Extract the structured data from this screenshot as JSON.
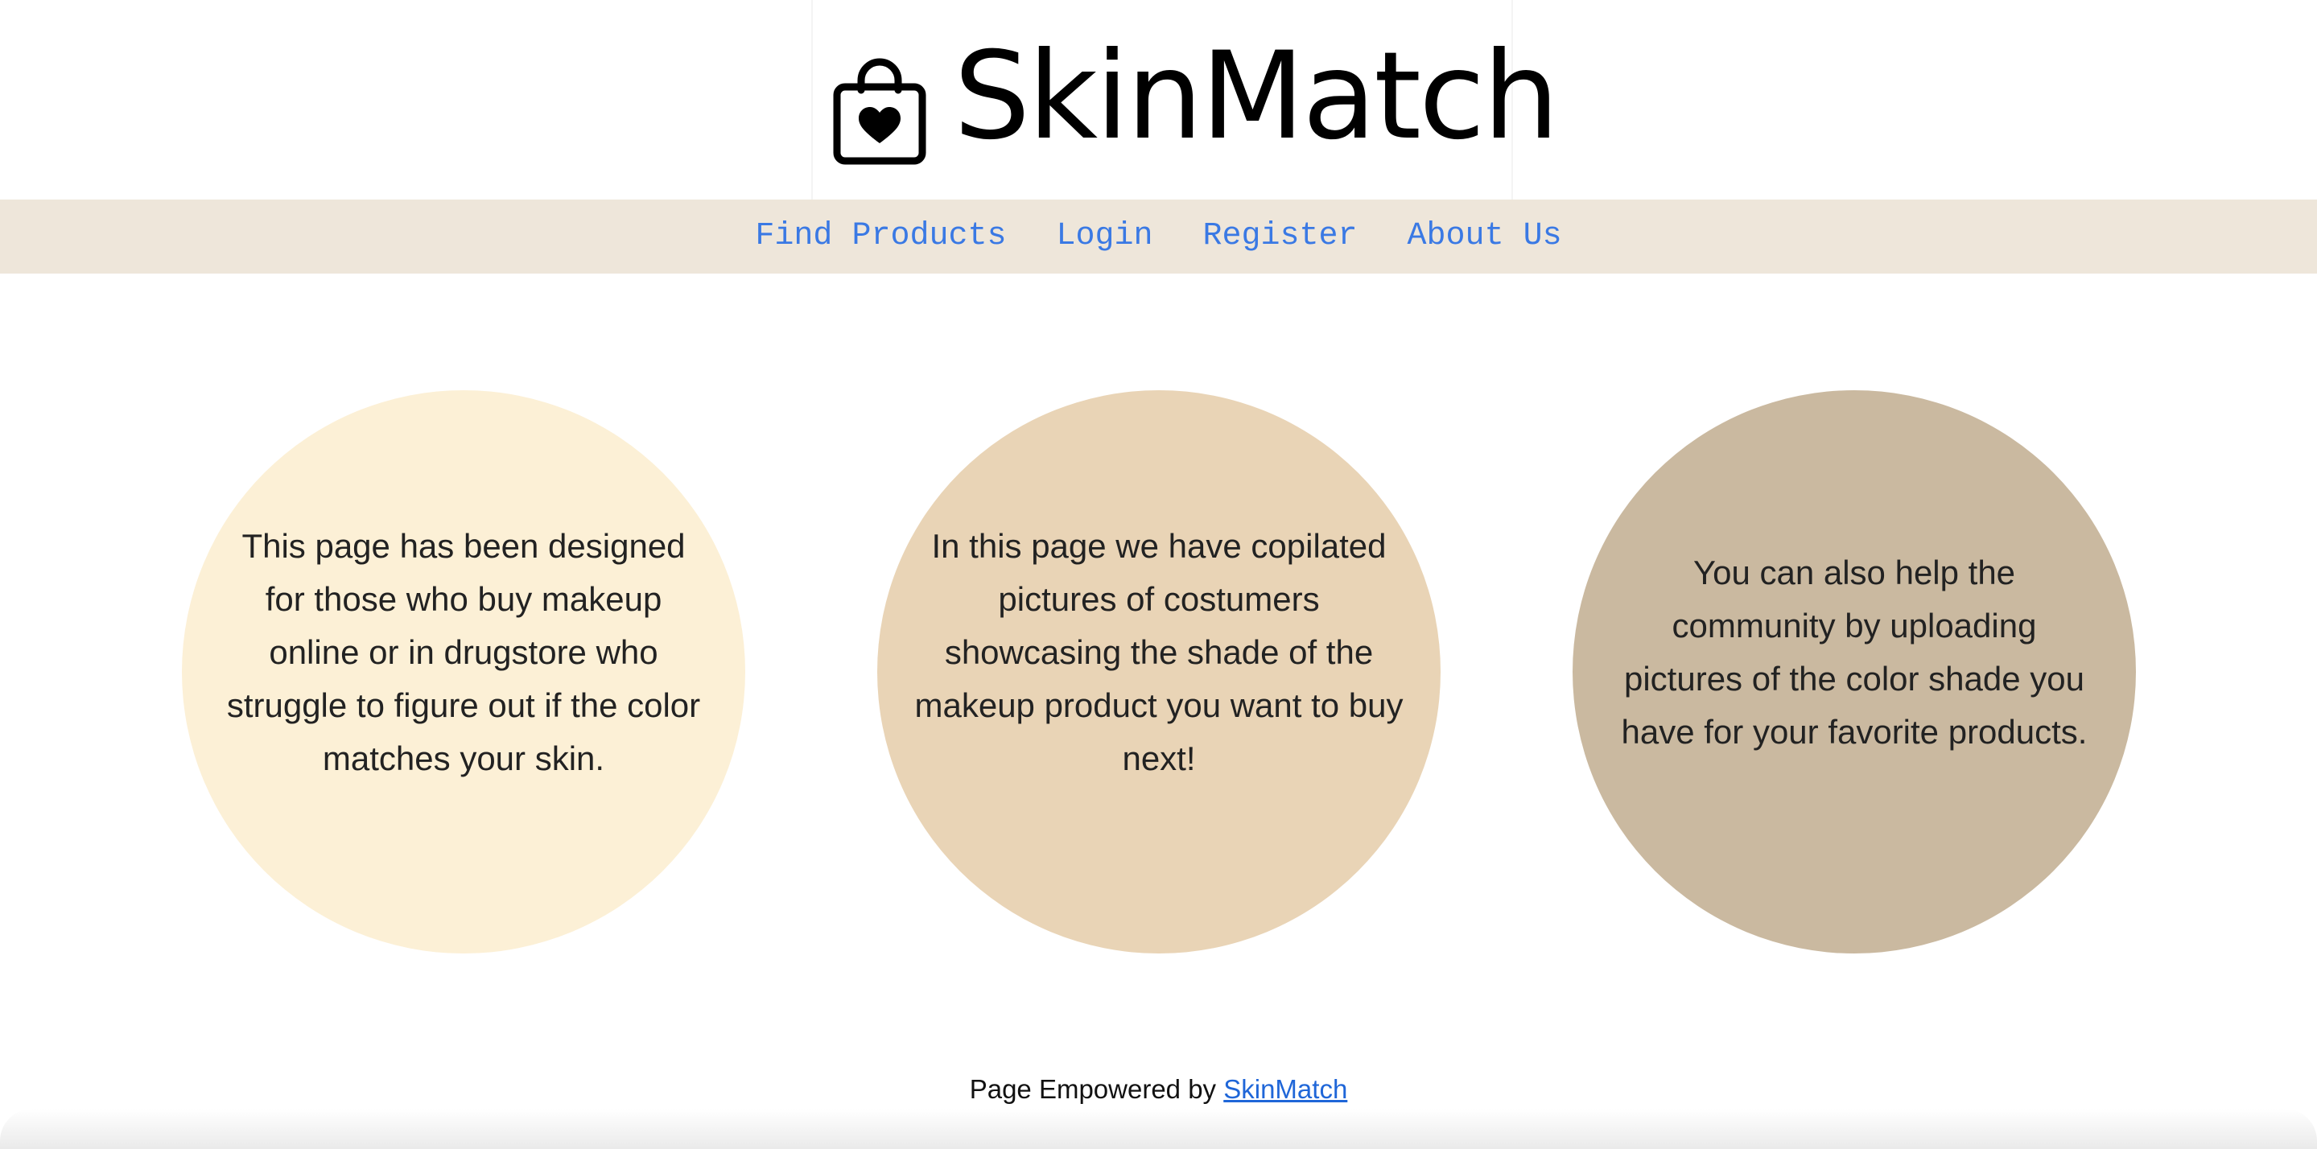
{
  "header": {
    "logo_icon": "shopping-bag-heart-icon",
    "logo_text": "SkinMatch"
  },
  "nav": {
    "items": [
      {
        "label": "Find Products"
      },
      {
        "label": "Login"
      },
      {
        "label": "Register"
      },
      {
        "label": "About Us"
      }
    ]
  },
  "circles": [
    {
      "text": "This page has been designed for those who buy makeup online or in drugstore who struggle to figure out if the color matches your skin.",
      "color": "#fcf0d6"
    },
    {
      "text": "In this page we have copilated pictures of costumers showcasing the shade of the makeup product you want to buy next!",
      "color": "#e9d4b6"
    },
    {
      "text": "You can also help the community by uploading pictures of the color shade you have for your favorite products.",
      "color": "#cab9a0"
    }
  ],
  "footer": {
    "prefix": "Page Empowered by",
    "link_text": "SkinMatch"
  },
  "colors": {
    "nav_background": "#eee6da",
    "link": "#3a79e4"
  }
}
